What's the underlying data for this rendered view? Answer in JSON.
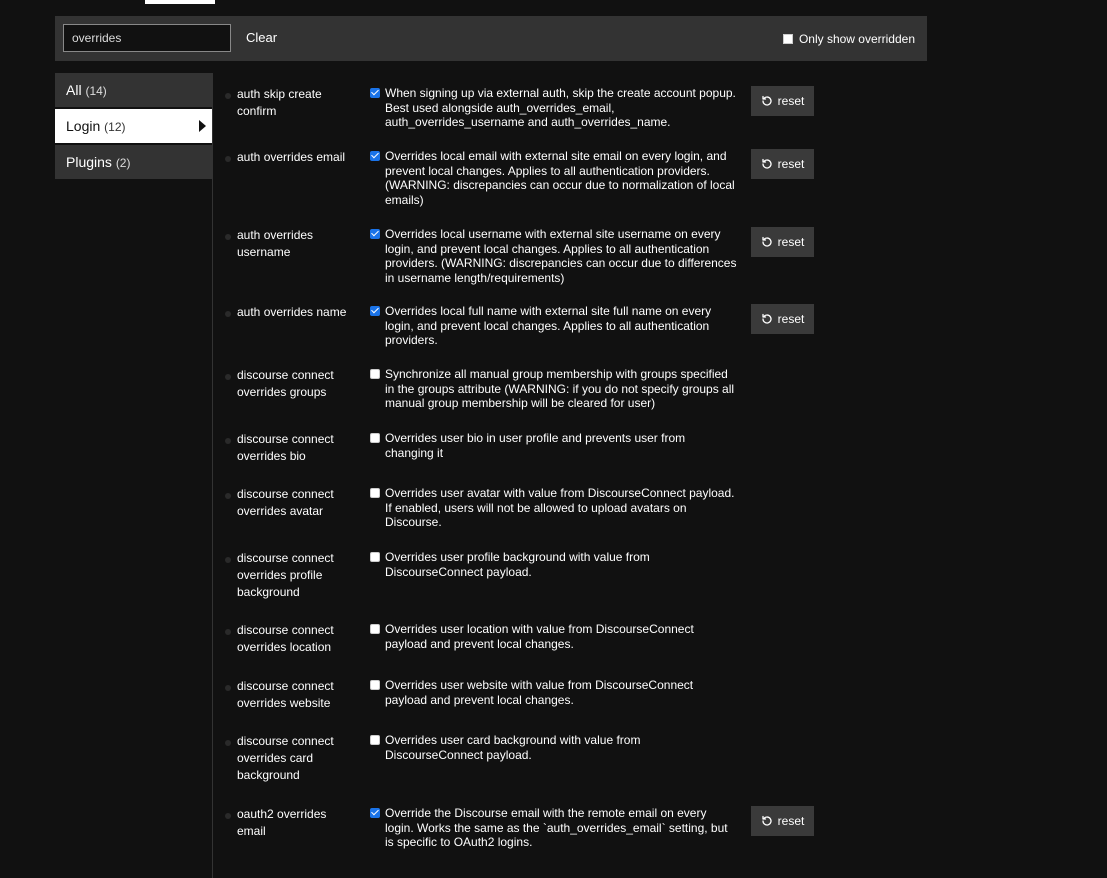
{
  "filter": {
    "value": "overrides",
    "clear_label": "Clear",
    "only_overridden_label": "Only show overridden"
  },
  "sidebar": {
    "items": [
      {
        "label": "All",
        "count": "(14)"
      },
      {
        "label": "Login",
        "count": "(12)"
      },
      {
        "label": "Plugins",
        "count": "(2)"
      }
    ]
  },
  "reset_label": "reset",
  "settings": [
    {
      "name": "auth skip create confirm",
      "checked": true,
      "desc": "When signing up via external auth, skip the create account popup. Best used alongside auth_overrides_email, auth_overrides_username and auth_overrides_name."
    },
    {
      "name": "auth overrides email",
      "checked": true,
      "desc": "Overrides local email with external site email on every login, and prevent local changes. Applies to all authentication providers. (WARNING: discrepancies can occur due to normalization of local emails)"
    },
    {
      "name": "auth overrides username",
      "checked": true,
      "desc": "Overrides local username with external site username on every login, and prevent local changes. Applies to all authentication providers. (WARNING: discrepancies can occur due to differences in username length/requirements)"
    },
    {
      "name": "auth overrides name",
      "checked": true,
      "desc": "Overrides local full name with external site full name on every login, and prevent local changes. Applies to all authentication providers."
    },
    {
      "name": "discourse connect overrides groups",
      "checked": false,
      "desc": "Synchronize all manual group membership with groups specified in the groups attribute (WARNING: if you do not specify groups all manual group membership will be cleared for user)"
    },
    {
      "name": "discourse connect overrides bio",
      "checked": false,
      "desc": "Overrides user bio in user profile and prevents user from changing it"
    },
    {
      "name": "discourse connect overrides avatar",
      "checked": false,
      "desc": "Overrides user avatar with value from DiscourseConnect payload. If enabled, users will not be allowed to upload avatars on Discourse."
    },
    {
      "name": "discourse connect overrides profile background",
      "checked": false,
      "desc": "Overrides user profile background with value from DiscourseConnect payload."
    },
    {
      "name": "discourse connect overrides location",
      "checked": false,
      "desc": "Overrides user location with value from DiscourseConnect payload and prevent local changes."
    },
    {
      "name": "discourse connect overrides website",
      "checked": false,
      "desc": "Overrides user website with value from DiscourseConnect payload and prevent local changes."
    },
    {
      "name": "discourse connect overrides card background",
      "checked": false,
      "desc": "Overrides user card background with value from DiscourseConnect payload."
    },
    {
      "name": "oauth2 overrides email",
      "checked": true,
      "desc": "Override the Discourse email with the remote email on every login. Works the same as the `auth_overrides_email` setting, but is specific to OAuth2 logins."
    }
  ]
}
